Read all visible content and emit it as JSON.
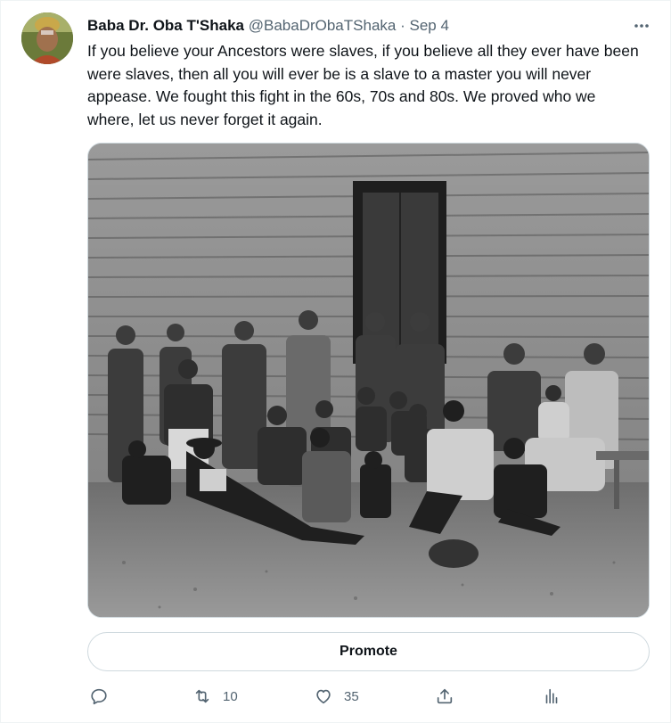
{
  "tweet": {
    "author_name": "Baba Dr. Oba T'Shaka",
    "handle": "@BabaDrObaTShaka",
    "separator": "·",
    "date": "Sep 4",
    "text": "If you believe your Ancestors were slaves, if you believe all they ever have been were slaves, then all you will ever be is a slave to a master you will never appease. We fought this fight in the 60s, 70s and 80s. We proved who we where, let us never forget it again.",
    "media_alt": "Historical black-and-white photograph of a group of people sitting and standing in front of a wooden building with an open doorway"
  },
  "promote": {
    "label": "Promote"
  },
  "actions": {
    "reply": {
      "icon": "reply-icon"
    },
    "retweet": {
      "icon": "retweet-icon",
      "count": "10"
    },
    "like": {
      "icon": "heart-icon",
      "count": "35"
    },
    "share": {
      "icon": "share-icon"
    },
    "analytics": {
      "icon": "analytics-icon"
    }
  },
  "colors": {
    "text": "#0f1419",
    "secondary": "#536471",
    "border": "#cfd9de"
  }
}
